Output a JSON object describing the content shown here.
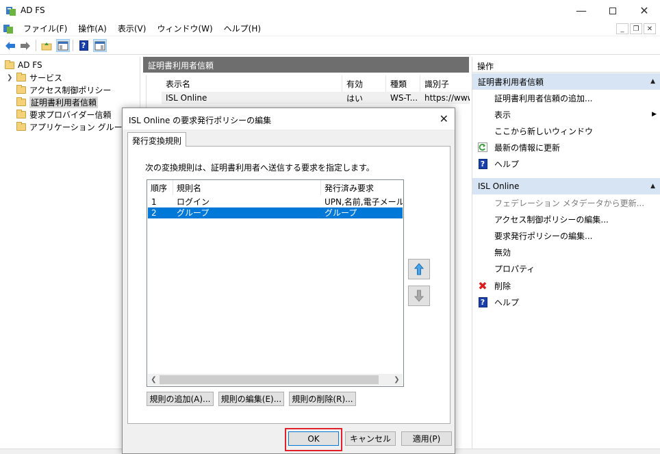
{
  "window": {
    "title": "AD FS"
  },
  "menu": [
    {
      "label": "ファイル(F)"
    },
    {
      "label": "操作(A)"
    },
    {
      "label": "表示(V)"
    },
    {
      "label": "ウィンドウ(W)"
    },
    {
      "label": "ヘルプ(H)"
    }
  ],
  "tree": {
    "root": "AD FS",
    "items": [
      {
        "label": "サービス"
      },
      {
        "label": "アクセス制御ポリシー"
      },
      {
        "label": "証明書利用者信頼"
      },
      {
        "label": "要求プロバイダー信頼"
      },
      {
        "label": "アプリケーション グループ"
      }
    ]
  },
  "center": {
    "header": "証明書利用者信頼",
    "columns": [
      "表示名",
      "有効",
      "種類",
      "識別子"
    ],
    "row": [
      "ISL Online",
      "はい",
      "WS-T...",
      "https://www"
    ]
  },
  "actions": {
    "title": "操作",
    "section1": {
      "title": "証明書利用者信頼",
      "items": [
        {
          "label": "証明書利用者信頼の追加..."
        },
        {
          "label": "表示"
        },
        {
          "label": "ここから新しいウィンドウ"
        },
        {
          "label": "最新の情報に更新"
        },
        {
          "label": "ヘルプ"
        }
      ]
    },
    "section2": {
      "title": "ISL Online",
      "items": [
        {
          "label": "フェデレーション メタデータから更新..."
        },
        {
          "label": "アクセス制御ポリシーの編集..."
        },
        {
          "label": "要求発行ポリシーの編集..."
        },
        {
          "label": "無効"
        },
        {
          "label": "プロパティ"
        },
        {
          "label": "削除"
        },
        {
          "label": "ヘルプ"
        }
      ]
    }
  },
  "dialog": {
    "title": "ISL Online の要求発行ポリシーの編集",
    "tab": "発行変換規則",
    "description": "次の変換規則は、証明書利用者へ送信する要求を指定します。",
    "columns": [
      "順序",
      "規則名",
      "発行済み要求"
    ],
    "rows": [
      {
        "order": "1",
        "name": "ログイン",
        "claims": "UPN,名前,電子メール ア"
      },
      {
        "order": "2",
        "name": "グループ",
        "claims": "グループ"
      }
    ],
    "buttons": {
      "add": "規則の追加(A)...",
      "edit": "規則の編集(E)...",
      "delete": "規則の削除(R)...",
      "ok": "OK",
      "cancel": "キャンセル",
      "apply": "適用(P)"
    }
  },
  "colors": {
    "selection": "#0078d7",
    "section_bg": "#d6e4f3",
    "header_bg": "#6e6e6e",
    "highlight": "#e0202a"
  }
}
